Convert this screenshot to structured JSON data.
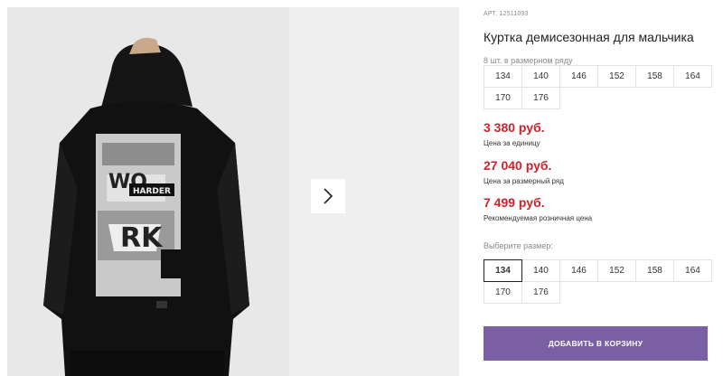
{
  "gallery": {
    "main_photo_alt": "",
    "next_icon": "chevron-right-icon"
  },
  "product": {
    "article": "АРТ. 12511093",
    "title": "Куртка демисезонная для мальчика",
    "row_label": "8 шт. в размерном ряду",
    "row_sizes": [
      "134",
      "140",
      "146",
      "152",
      "158",
      "164",
      "170",
      "176"
    ],
    "prices": [
      {
        "value": "3 380 руб.",
        "note": "Цена за единицу"
      },
      {
        "value": "27 040 руб.",
        "note": "Цена за размерный ряд"
      },
      {
        "value": "7 499 руб.",
        "note": "Рекомендуемая розничная цена"
      }
    ],
    "choose_label": "Выберите размер:",
    "choose_sizes": [
      "134",
      "140",
      "146",
      "152",
      "158",
      "164",
      "170",
      "176"
    ],
    "selected_size": "134",
    "cart_button": "ДОБАВИТЬ В КОРЗИНУ"
  },
  "colors": {
    "price": "#d61f26",
    "cart_button_bg": "#7b5fa3"
  }
}
